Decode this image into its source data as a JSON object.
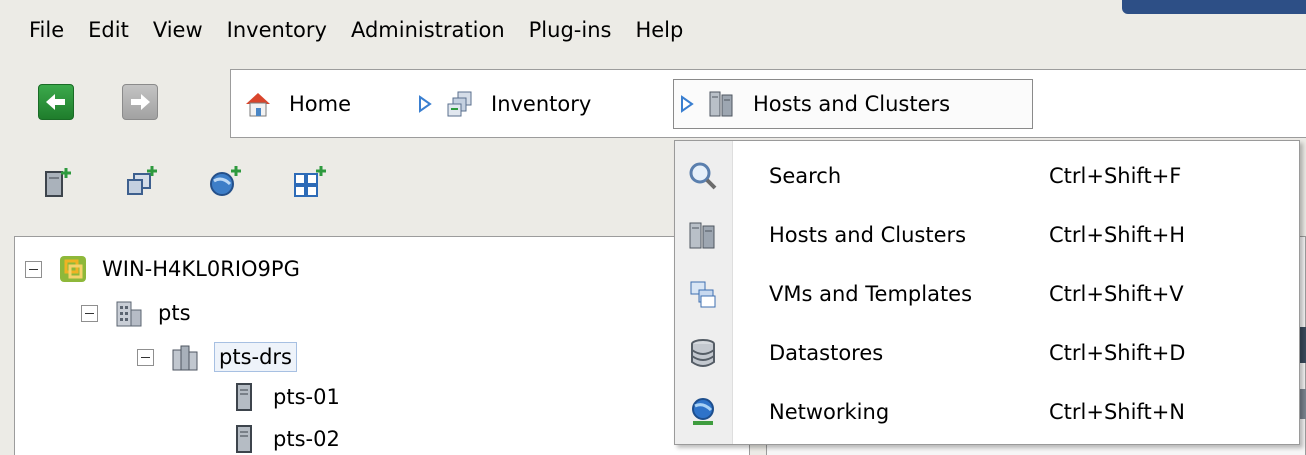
{
  "menubar": {
    "items": [
      "File",
      "Edit",
      "View",
      "Inventory",
      "Administration",
      "Plug-ins",
      "Help"
    ]
  },
  "breadcrumb": {
    "items": [
      {
        "label": "Home",
        "icon": "home-icon"
      },
      {
        "label": "Inventory",
        "icon": "inventory-icon"
      },
      {
        "label": "Hosts and Clusters",
        "icon": "hosts-clusters-icon"
      }
    ]
  },
  "toolbar": {
    "nav": [
      "back-arrow-icon",
      "forward-arrow-icon"
    ],
    "actions": [
      "new-host-icon",
      "new-cluster-icon",
      "new-datacenter-icon",
      "new-resource-pool-icon"
    ]
  },
  "tree": {
    "root": "WIN-H4KL0RIO9PG",
    "datacenter": "pts",
    "cluster": "pts-drs",
    "hosts": [
      "pts-01",
      "pts-02"
    ]
  },
  "dropdown": {
    "items": [
      {
        "label": "Search",
        "shortcut": "Ctrl+Shift+F",
        "icon": "search-icon"
      },
      {
        "label": "Hosts and Clusters",
        "shortcut": "Ctrl+Shift+H",
        "icon": "hosts-clusters-icon"
      },
      {
        "label": "VMs and Templates",
        "shortcut": "Ctrl+Shift+V",
        "icon": "vms-templates-icon"
      },
      {
        "label": "Datastores",
        "shortcut": "Ctrl+Shift+D",
        "icon": "datastore-icon"
      },
      {
        "label": "Networking",
        "shortcut": "Ctrl+Shift+N",
        "icon": "networking-icon"
      }
    ]
  },
  "colors": {
    "accent": "#2d4f86",
    "back_button": "#2e9a3e",
    "selection_border": "#a7c0e2"
  }
}
